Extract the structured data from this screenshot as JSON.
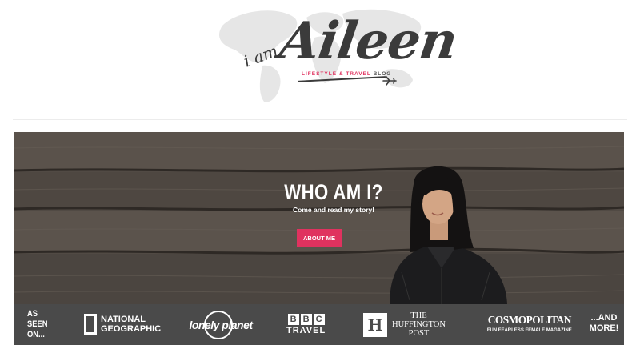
{
  "header": {
    "logo_prefix": "i am",
    "logo_name": "Aileen",
    "logo_tagline": "LIFESTYLE & TRAVEL",
    "logo_tagline_suffix": "BLOG"
  },
  "hero": {
    "title": "WHO AM I?",
    "subtitle": "Come and read my story!",
    "button_label": "ABOUT ME"
  },
  "as_seen_on": {
    "intro_lines": [
      "AS",
      "SEEN",
      "ON..."
    ],
    "brands": {
      "natgeo_line1": "NATIONAL",
      "natgeo_line2": "GEOGRAPHIC",
      "lonely_planet": "lonely planet",
      "bbc_letters": [
        "B",
        "B",
        "C"
      ],
      "bbc_travel": "TRAVEL",
      "huff_letter": "H",
      "huff_lines": [
        "THE",
        "HUFFINGTON",
        "POST"
      ],
      "cosmo_name": "COSMOPOLITAN",
      "cosmo_sub": "FUN FEARLESS FEMALE MAGAZINE"
    },
    "more_lines": [
      "...AND",
      "MORE!"
    ]
  },
  "colors": {
    "accent": "#e0325f",
    "bar_bg": "#4a4a4a",
    "logo_text": "#3b3b3b"
  },
  "icons": [
    "world-map-icon",
    "plane-icon"
  ]
}
